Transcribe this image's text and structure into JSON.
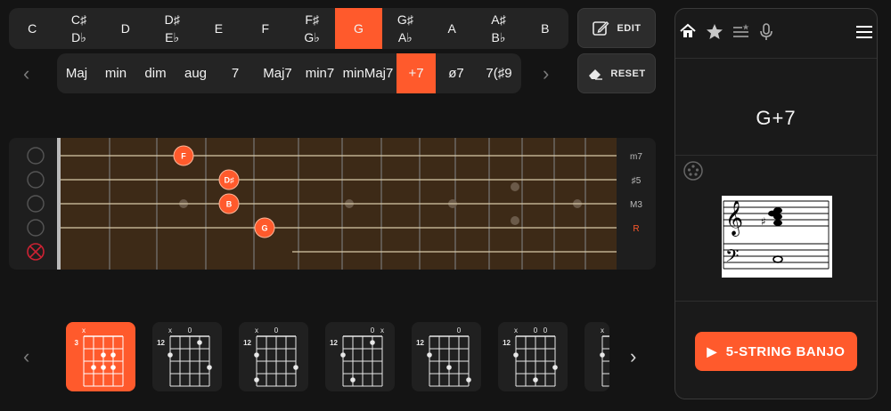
{
  "keys": [
    {
      "top": "C",
      "bottom": ""
    },
    {
      "top": "C♯",
      "bottom": "D♭"
    },
    {
      "top": "D",
      "bottom": ""
    },
    {
      "top": "D♯",
      "bottom": "E♭"
    },
    {
      "top": "E",
      "bottom": ""
    },
    {
      "top": "F",
      "bottom": ""
    },
    {
      "top": "F♯",
      "bottom": "G♭"
    },
    {
      "top": "G",
      "bottom": ""
    },
    {
      "top": "G♯",
      "bottom": "A♭"
    },
    {
      "top": "A",
      "bottom": ""
    },
    {
      "top": "A♯",
      "bottom": "B♭"
    },
    {
      "top": "B",
      "bottom": ""
    }
  ],
  "selected_key": "G",
  "chord_types": [
    "Maj",
    "min",
    "dim",
    "aug",
    "7",
    "Maj7",
    "min7",
    "minMaj7",
    "+7",
    "ø7",
    "7(♯9"
  ],
  "selected_chord_type": "+7",
  "controls": {
    "edit_label": "EDIT",
    "reset_label": "RESET"
  },
  "fretboard": {
    "notes": [
      {
        "label": "F",
        "string": 1,
        "fret": 5
      },
      {
        "label": "D♯",
        "string": 2,
        "fret": 6
      },
      {
        "label": "B",
        "string": 3,
        "fret": 6
      },
      {
        "label": "G",
        "string": 4,
        "fret": 7
      }
    ],
    "intervals": [
      "m7",
      "♯5",
      "M3",
      "R"
    ],
    "root_color": "#ff5a2c"
  },
  "voicings": [
    {
      "fret_label": "3",
      "markers": [
        "x",
        "",
        "",
        "",
        ""
      ],
      "active": true
    },
    {
      "fret_label": "12",
      "markers": [
        "x",
        "",
        "0",
        "",
        ""
      ],
      "active": false
    },
    {
      "fret_label": "12",
      "markers": [
        "x",
        "",
        "0",
        "",
        ""
      ],
      "active": false
    },
    {
      "fret_label": "12",
      "markers": [
        "",
        "",
        "",
        "0",
        "x"
      ],
      "active": false
    },
    {
      "fret_label": "12",
      "markers": [
        "",
        "",
        "",
        "0",
        ""
      ],
      "active": false
    },
    {
      "fret_label": "12",
      "markers": [
        "x",
        "",
        "0",
        "0",
        ""
      ],
      "active": false
    },
    {
      "fret_label": "",
      "markers": [
        "x",
        "",
        "",
        "",
        ""
      ],
      "active": false
    }
  ],
  "panel": {
    "icons": [
      "home-icon",
      "star-icon",
      "playlist-icon",
      "microphone-icon",
      "menu-icon"
    ],
    "chord_name": "G+7",
    "play_label": "5-STRING BANJO"
  },
  "colors": {
    "accent": "#ff5a2c",
    "wood": "#3d2a17"
  }
}
